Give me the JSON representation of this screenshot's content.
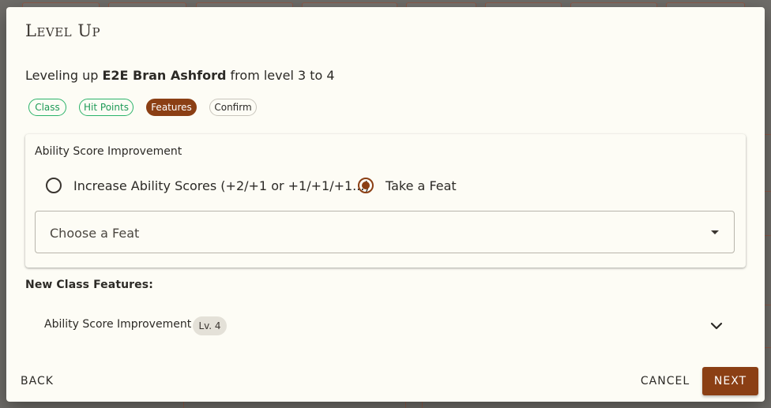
{
  "dialog": {
    "title": "Level Up",
    "subtitle": {
      "prefix": "Leveling up ",
      "character": "E2E Bran Ashford",
      "suffix": " from level 3 to 4"
    }
  },
  "steps": [
    {
      "label": "Class",
      "state": "done"
    },
    {
      "label": "Hit Points",
      "state": "done"
    },
    {
      "label": "Features",
      "state": "active"
    },
    {
      "label": "Confirm",
      "state": "pending"
    }
  ],
  "asi_card": {
    "title": "Ability Score Improvement",
    "options": [
      {
        "label": "Increase Ability Scores (+2/+1 or +1/+1/+1...)",
        "checked": false
      },
      {
        "label": "Take a Feat",
        "checked": true
      }
    ],
    "feat_select": {
      "placeholder": "Choose a Feat"
    }
  },
  "class_features": {
    "heading": "New Class Features:",
    "items": [
      {
        "name": "Ability Score Improvement",
        "level_chip": "Lv. 4"
      }
    ]
  },
  "footer": {
    "back_label": "Back",
    "cancel_label": "Cancel",
    "next_label": "Next"
  },
  "colors": {
    "accent": "#8b3f14",
    "done": "#1d9a57",
    "dialog_bg": "#fdfcf5"
  },
  "icons": {
    "select_caret": "caret-down-icon",
    "feature_expand": "chevron-down-icon"
  }
}
